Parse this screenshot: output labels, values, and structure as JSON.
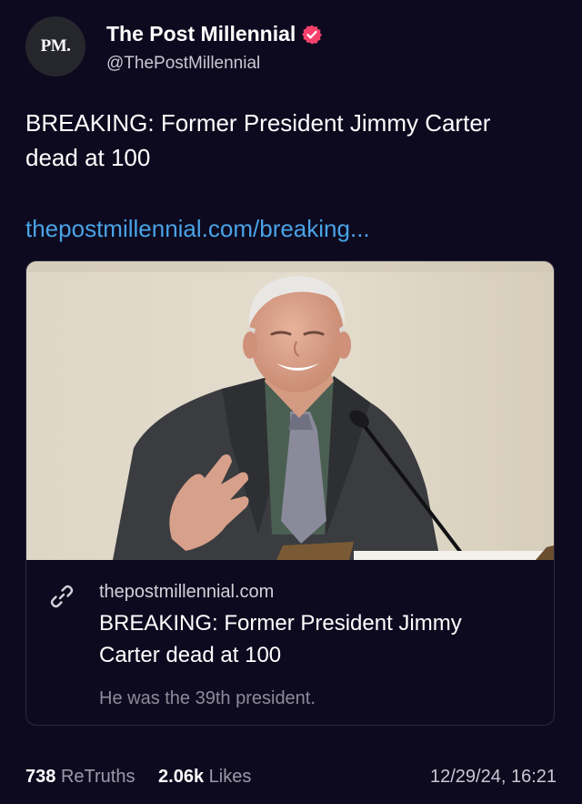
{
  "account": {
    "avatar_text": "PM.",
    "name": "The Post Millennial",
    "handle": "@ThePostMillennial",
    "verified_icon": "verified-badge-icon",
    "verified_color": "#f4416c"
  },
  "post": {
    "text": "BREAKING: Former President Jimmy Carter dead at 100",
    "link_text": "thepostmillennial.com/breaking...",
    "link_color": "#49a3e6"
  },
  "card": {
    "image_icon": "news-photo",
    "link_icon": "link-icon",
    "domain": "thepostmillennial.com",
    "title": "BREAKING: Former President Jimmy Carter dead at 100",
    "description": "He was the 39th president."
  },
  "stats": {
    "retruths_count": "738",
    "retruths_label": "ReTruths",
    "likes_count": "2.06k",
    "likes_label": "Likes",
    "timestamp": "12/29/24, 16:21"
  }
}
